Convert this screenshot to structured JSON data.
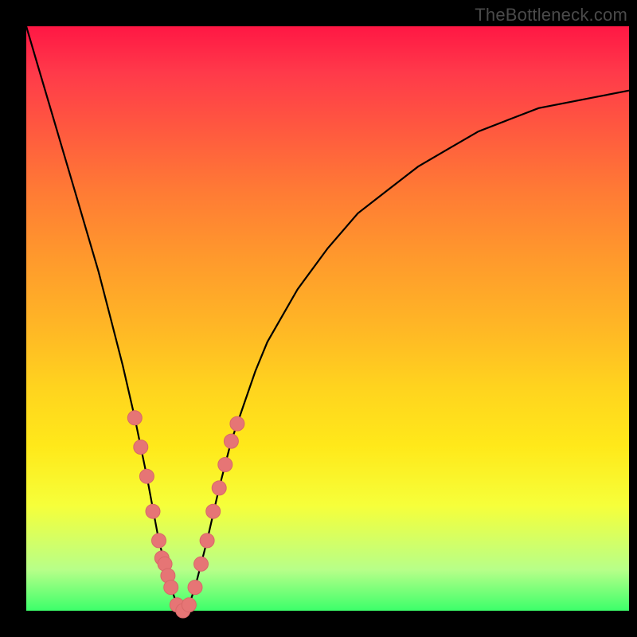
{
  "watermark": "TheBottleneck.com",
  "chart_data": {
    "type": "line",
    "title": "",
    "xlabel": "",
    "ylabel": "",
    "xlim": [
      0,
      100
    ],
    "ylim": [
      0,
      100
    ],
    "grid": false,
    "legend": false,
    "background_gradient": {
      "top": "#ff1744",
      "middle": "#ffd41e",
      "bottom": "#3cff6a"
    },
    "series": [
      {
        "name": "bottleneck-curve",
        "color": "#000000",
        "x": [
          0,
          2,
          4,
          6,
          8,
          10,
          12,
          14,
          16,
          18,
          20,
          22,
          24,
          25,
          26,
          27,
          28,
          30,
          32,
          34,
          36,
          38,
          40,
          45,
          50,
          55,
          60,
          65,
          70,
          75,
          80,
          85,
          90,
          95,
          100
        ],
        "values": [
          100,
          93,
          86,
          79,
          72,
          65,
          58,
          50,
          42,
          33,
          23,
          12,
          4,
          1,
          0,
          1,
          4,
          12,
          21,
          29,
          35,
          41,
          46,
          55,
          62,
          68,
          72,
          76,
          79,
          82,
          84,
          86,
          87,
          88,
          89
        ]
      }
    ],
    "markers": {
      "name": "curve-highlight-dots",
      "color": "#e67575",
      "shape": "circle",
      "x": [
        18,
        19,
        20,
        21,
        22,
        22.5,
        23,
        23.5,
        24,
        25,
        26,
        27,
        28,
        29,
        30,
        31,
        32,
        33,
        34,
        35
      ],
      "values": [
        33,
        28,
        23,
        17,
        12,
        9,
        8,
        6,
        4,
        1,
        0,
        1,
        4,
        8,
        12,
        17,
        21,
        25,
        29,
        32
      ]
    }
  }
}
